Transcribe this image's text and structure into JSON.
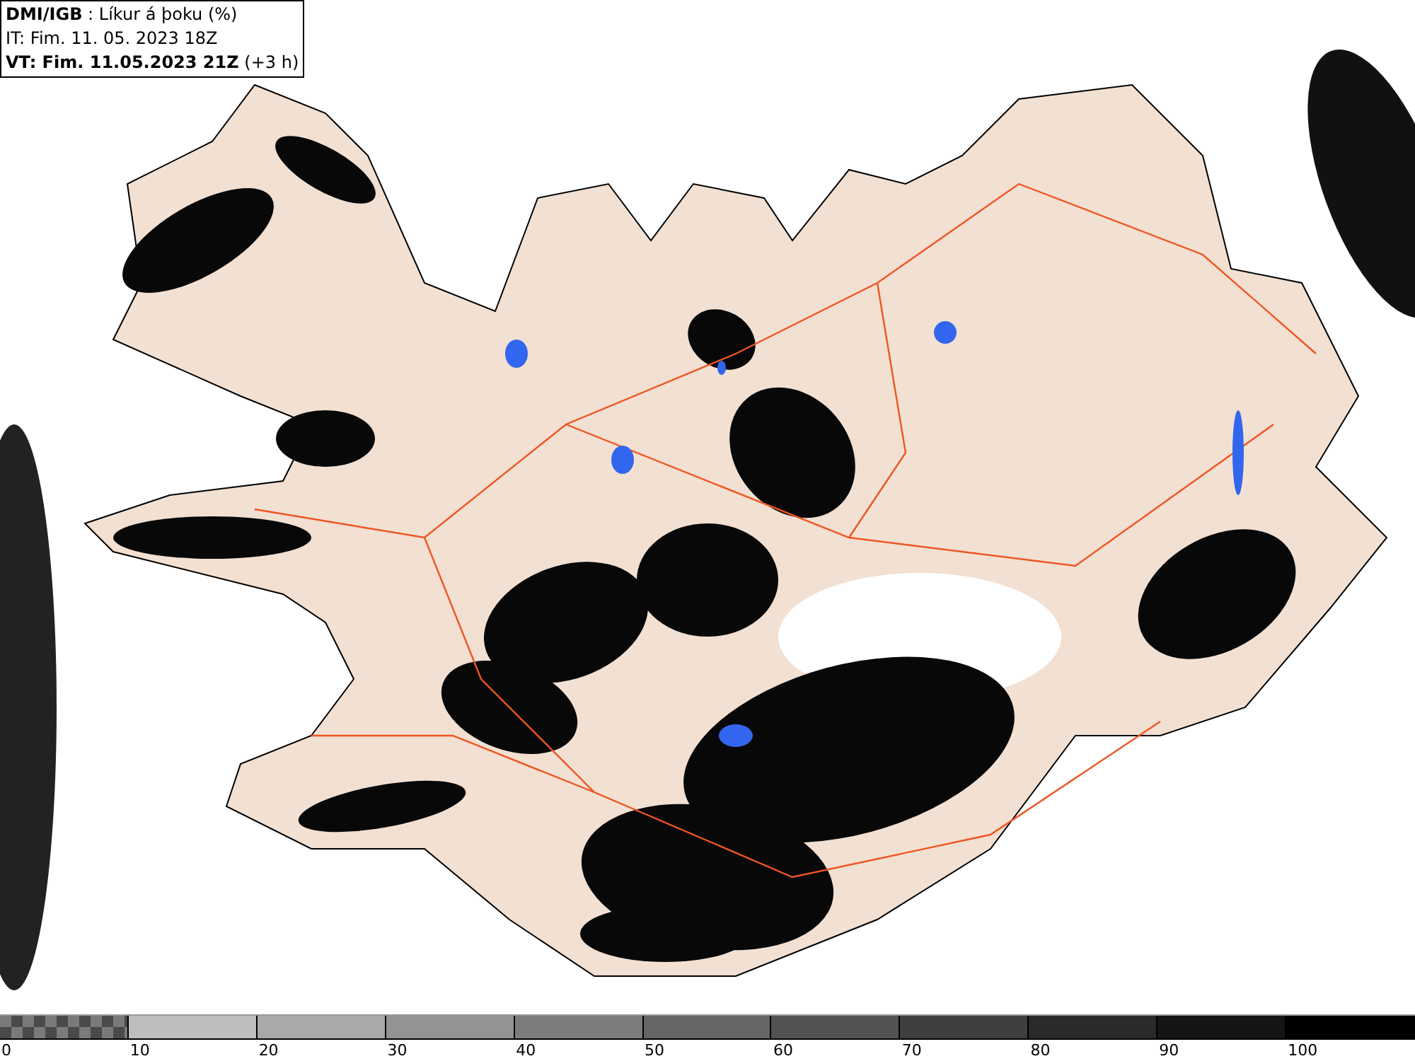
{
  "header": {
    "lines": [
      "**DMI/IGB** : Líkur á þoku (%)",
      "IT: Fim. 11. 05. 2023 18Z",
      "**VT: Fim. 11.05.2023 21Z** (+3 h)"
    ]
  },
  "legend": {
    "bins": [
      {
        "label": "0",
        "kind": "checker"
      },
      {
        "label": "10",
        "kind": "solid",
        "color": "#bebebe"
      },
      {
        "label": "20",
        "kind": "solid",
        "color": "#a9a9a9"
      },
      {
        "label": "30",
        "kind": "solid",
        "color": "#939393"
      },
      {
        "label": "40",
        "kind": "solid",
        "color": "#7c7c7c"
      },
      {
        "label": "50",
        "kind": "solid",
        "color": "#666666"
      },
      {
        "label": "60",
        "kind": "solid",
        "color": "#525252"
      },
      {
        "label": "70",
        "kind": "solid",
        "color": "#3f3f3f"
      },
      {
        "label": "80",
        "kind": "solid",
        "color": "#2a2a2a"
      },
      {
        "label": "90",
        "kind": "solid",
        "color": "#151515"
      },
      {
        "label": "100",
        "kind": "solid",
        "color": "#000000"
      }
    ]
  }
}
